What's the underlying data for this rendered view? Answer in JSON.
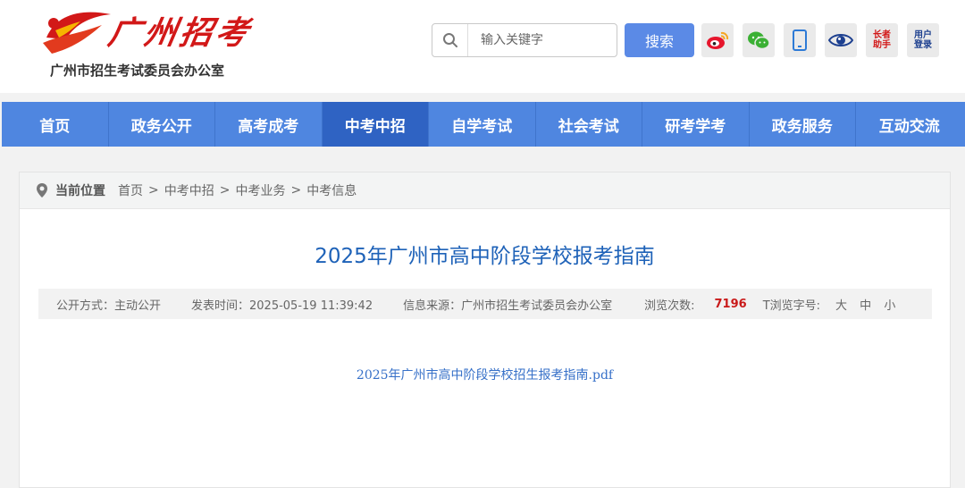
{
  "header": {
    "logo_script": "广州招考",
    "logo_subtitle": "广州市招生考试委员会办公室"
  },
  "search": {
    "placeholder": "输入关键字",
    "button_label": "搜索"
  },
  "tools": {
    "weibo": "weibo-icon",
    "wechat": "wechat-icon",
    "mobile": "mobile-icon",
    "accessibility": "eye-icon",
    "elder_label": "长者助手",
    "login_label": "用户登录"
  },
  "nav": {
    "items": [
      "首页",
      "政务公开",
      "高考成考",
      "中考中招",
      "自学考试",
      "社会考试",
      "研考学考",
      "政务服务",
      "互动交流"
    ],
    "active_index": 3
  },
  "breadcrumb": {
    "label": "当前位置",
    "items": [
      "首页",
      "中考中招",
      "中考业务",
      "中考信息"
    ],
    "separator": ">"
  },
  "article": {
    "title": "2025年广州市高中阶段学校报考指南",
    "meta": {
      "disclosure": "公开方式：主动公开",
      "publish_time": "发表时间：2025-05-19 11:39:42",
      "source": "信息来源：广州市招生考试委员会办公室",
      "views_label": "浏览次数:",
      "views": "7196",
      "font_label": "T浏览字号:",
      "font_sizes": [
        "大",
        "中",
        "小"
      ]
    },
    "attachment": "2025年广州市高中阶段学校招生报考指南.pdf"
  },
  "colors": {
    "nav_bg": "#4f86e0",
    "nav_active": "#2f63c3",
    "title": "#1e62b8",
    "logo_red": "#d21818",
    "views_red": "#c91a1a"
  }
}
